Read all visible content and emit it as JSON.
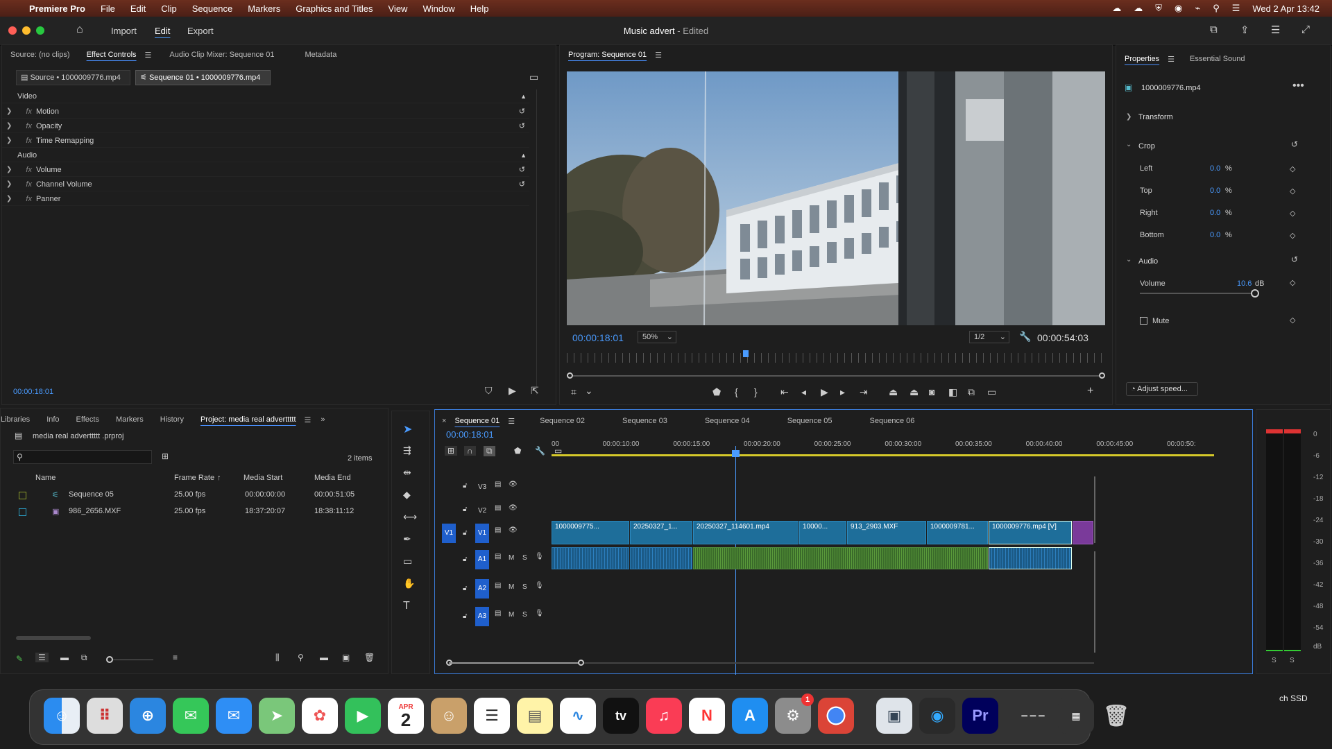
{
  "menubar": {
    "app": "Premiere Pro",
    "items": [
      "File",
      "Edit",
      "Clip",
      "Sequence",
      "Markers",
      "Graphics and Titles",
      "View",
      "Window",
      "Help"
    ],
    "datetime": "Wed 2 Apr  13:42"
  },
  "header": {
    "nav": [
      "Import",
      "Edit",
      "Export"
    ],
    "active_nav": "Edit",
    "project_title": "Music advert",
    "status": "- Edited"
  },
  "source_panel": {
    "tabs": [
      "Source: (no clips)",
      "Effect Controls",
      "Audio Clip Mixer: Sequence 01",
      "Metadata"
    ],
    "active_tab": "Effect Controls",
    "source_chip": "Source • 1000009776.mp4",
    "sequence_chip": "Sequence 01 • 1000009776.mp4",
    "video_section": "Video",
    "video_effects": [
      "Motion",
      "Opacity",
      "Time Remapping"
    ],
    "audio_section": "Audio",
    "audio_effects": [
      "Volume",
      "Channel Volume",
      "Panner"
    ],
    "timecode": "00:00:18:01"
  },
  "program_panel": {
    "title": "Program: Sequence 01",
    "timecode": "00:00:18:01",
    "zoom": "50%",
    "resolution": "1/2",
    "duration": "00:00:54:03",
    "playhead_fraction": 0.333
  },
  "properties_panel": {
    "tabs": [
      "Properties",
      "Essential Sound"
    ],
    "clip_name": "1000009776.mp4",
    "transform_label": "Transform",
    "crop_label": "Crop",
    "crop": [
      {
        "label": "Left",
        "value": "0.0",
        "unit": "%"
      },
      {
        "label": "Top",
        "value": "0.0",
        "unit": "%"
      },
      {
        "label": "Right",
        "value": "0.0",
        "unit": "%"
      },
      {
        "label": "Bottom",
        "value": "0.0",
        "unit": "%"
      }
    ],
    "audio_label": "Audio",
    "volume_label": "Volume",
    "volume_value": "10.6",
    "volume_unit": "dB",
    "mute_label": "Mute",
    "adjust_speed": "Adjust speed..."
  },
  "project_panel": {
    "tabs": [
      "Libraries",
      "Info",
      "Effects",
      "Markers",
      "History",
      "Project: media real adverttttt"
    ],
    "active_tab": "Project: media real adverttttt",
    "project_file": "media real adverttttt .prproj",
    "item_count": "2 items",
    "columns": [
      "Name",
      "Frame Rate",
      "Media Start",
      "Media End"
    ],
    "rows": [
      {
        "name": "Sequence 05",
        "frame_rate": "25.00 fps",
        "media_start": "00:00:00:00",
        "media_end": "00:00:51:05",
        "color": "#6b7a1e"
      },
      {
        "name": "986_2656.MXF",
        "frame_rate": "25.00 fps",
        "media_start": "18:37:20:07",
        "media_end": "18:38:11:12",
        "color": "#1b7a9a"
      }
    ]
  },
  "timeline": {
    "tabs": [
      "Sequence 01",
      "Sequence 02",
      "Sequence 03",
      "Sequence 04",
      "Sequence 05",
      "Sequence 06"
    ],
    "active_tab": "Sequence 01",
    "timecode": "00:00:18:01",
    "ruler": [
      "00",
      "00:00:10:00",
      "00:00:15:00",
      "00:00:20:00",
      "00:00:25:00",
      "00:00:30:00",
      "00:00:35:00",
      "00:00:40:00",
      "00:00:45:00",
      "00:00:50:"
    ],
    "video_tracks": [
      "V3",
      "V2",
      "V1"
    ],
    "audio_tracks": [
      "A1",
      "A2",
      "A3"
    ],
    "source_patch_v": "V1",
    "mute_label": "M",
    "solo_label": "S",
    "video_clips": [
      "1000009775...",
      "20250327_1...",
      "20250327_114601.mp4",
      "10000...",
      "913_2903.MXF",
      "1000009781...",
      "1000009776.mp4 [V]"
    ]
  },
  "audio_meter": {
    "scale": [
      "0",
      "-6",
      "-12",
      "-18",
      "-24",
      "-30",
      "-36",
      "-42",
      "-48",
      "-54",
      "dB"
    ],
    "solo": [
      "S",
      "S"
    ]
  },
  "desktop": {
    "disk_label": "ch SSD"
  },
  "dock": {
    "calendar_month": "APR",
    "calendar_day": "2",
    "settings_badge": "1",
    "tv_label": "tv",
    "pr_label": "Pr"
  },
  "colors": {
    "accent_blue": "#4a9bff",
    "track_blue": "#1f5fcc",
    "video_clip": "#1e6e9a",
    "audio_clip_green": "#3a6b2a",
    "menubar": "#5a2619"
  }
}
